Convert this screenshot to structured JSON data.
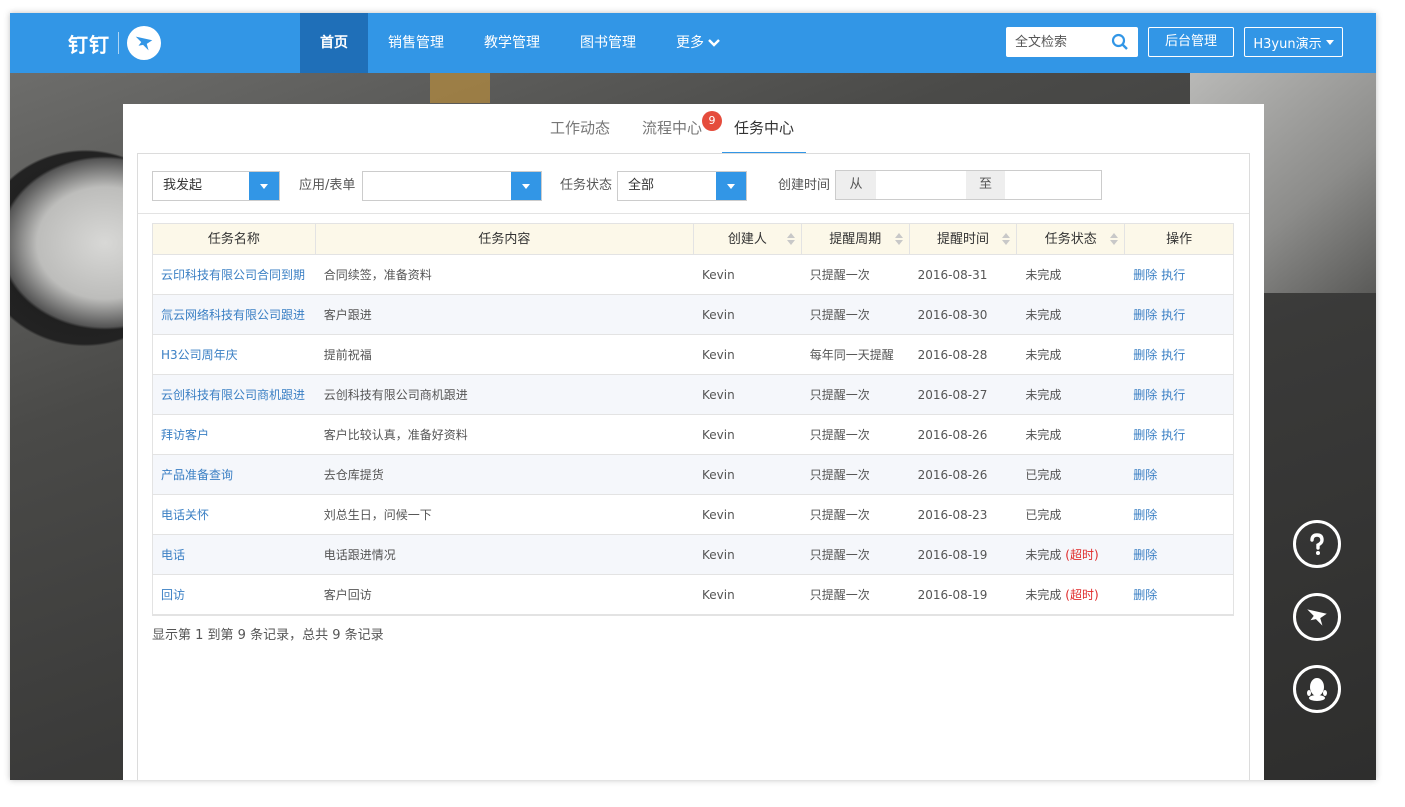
{
  "header": {
    "logo_text": "钉钉",
    "nav": [
      {
        "label": "首页",
        "active": true
      },
      {
        "label": "销售管理",
        "active": false
      },
      {
        "label": "教学管理",
        "active": false
      },
      {
        "label": "图书管理",
        "active": false
      },
      {
        "label": "更多",
        "active": false
      }
    ],
    "search_placeholder": "全文检索",
    "admin_label": "后台管理",
    "user_label": "H3yun演示",
    "accent_color": "#3296e6"
  },
  "tabs": [
    {
      "label": "工作动态",
      "active": false
    },
    {
      "label": "流程中心",
      "active": false,
      "badge": "9"
    },
    {
      "label": "任务中心",
      "active": true
    }
  ],
  "filters": {
    "initiator_value": "我发起",
    "app_form_label": "应用/表单",
    "app_form_value": "",
    "status_label": "任务状态",
    "status_value": "全部",
    "created_time_label": "创建时间",
    "from_label": "从",
    "to_label": "至"
  },
  "table": {
    "columns": [
      "任务名称",
      "任务内容",
      "创建人",
      "提醒周期",
      "提醒时间",
      "任务状态",
      "操作"
    ],
    "rows": [
      {
        "name": "云印科技有限公司合同到期",
        "content": "合同续签，准备资料",
        "creator": "Kevin",
        "cycle": "只提醒一次",
        "time": "2016-08-31",
        "status": "未完成",
        "overtime": "",
        "delete": "删除",
        "execute": "执行"
      },
      {
        "name": "氚云网络科技有限公司跟进",
        "content": "客户跟进",
        "creator": "Kevin",
        "cycle": "只提醒一次",
        "time": "2016-08-30",
        "status": "未完成",
        "overtime": "",
        "delete": "删除",
        "execute": "执行"
      },
      {
        "name": "H3公司周年庆",
        "content": "提前祝福",
        "creator": "Kevin",
        "cycle": "每年同一天提醒",
        "time": "2016-08-28",
        "status": "未完成",
        "overtime": "",
        "delete": "删除",
        "execute": "执行"
      },
      {
        "name": "云创科技有限公司商机跟进",
        "content": "云创科技有限公司商机跟进",
        "creator": "Kevin",
        "cycle": "只提醒一次",
        "time": "2016-08-27",
        "status": "未完成",
        "overtime": "",
        "delete": "删除",
        "execute": "执行"
      },
      {
        "name": "拜访客户",
        "content": "客户比较认真，准备好资料",
        "creator": "Kevin",
        "cycle": "只提醒一次",
        "time": "2016-08-26",
        "status": "未完成",
        "overtime": "",
        "delete": "删除",
        "execute": "执行"
      },
      {
        "name": "产品准备查询",
        "content": "去仓库提货",
        "creator": "Kevin",
        "cycle": "只提醒一次",
        "time": "2016-08-26",
        "status": "已完成",
        "overtime": "",
        "delete": "删除",
        "execute": ""
      },
      {
        "name": "电话关怀",
        "content": "刘总生日，问候一下",
        "creator": "Kevin",
        "cycle": "只提醒一次",
        "time": "2016-08-23",
        "status": "已完成",
        "overtime": "",
        "delete": "删除",
        "execute": ""
      },
      {
        "name": "电话",
        "content": "电话跟进情况",
        "creator": "Kevin",
        "cycle": "只提醒一次",
        "time": "2016-08-19",
        "status": "未完成",
        "overtime": "(超时)",
        "delete": "删除",
        "execute": ""
      },
      {
        "name": "回访",
        "content": "客户回访",
        "creator": "Kevin",
        "cycle": "只提醒一次",
        "time": "2016-08-19",
        "status": "未完成",
        "overtime": "(超时)",
        "delete": "删除",
        "execute": ""
      }
    ],
    "summary": "显示第 1 到第 9 条记录，总共 9 条记录"
  },
  "floating": [
    {
      "icon": "help-icon"
    },
    {
      "icon": "dingtalk-icon"
    },
    {
      "icon": "qq-icon"
    }
  ]
}
